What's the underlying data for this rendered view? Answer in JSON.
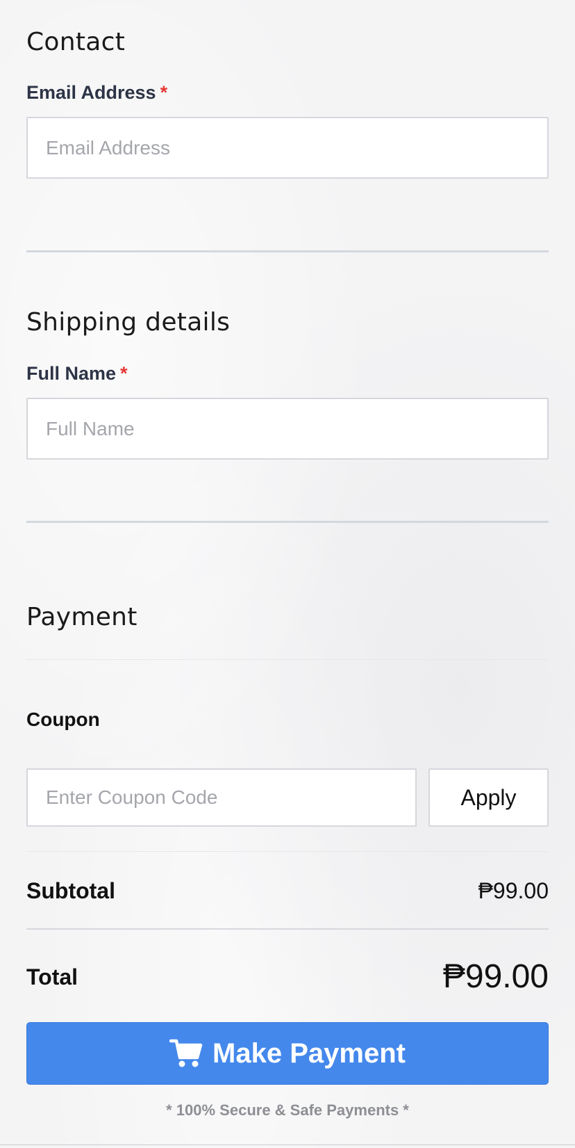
{
  "contact": {
    "title": "Contact",
    "email_label": "Email Address",
    "email_required": "*",
    "email_placeholder": "Email Address",
    "email_value": ""
  },
  "shipping": {
    "title": "Shipping details",
    "name_label": "Full Name",
    "name_required": "*",
    "name_placeholder": "Full Name",
    "name_value": ""
  },
  "payment": {
    "title": "Payment",
    "coupon_label": "Coupon",
    "coupon_placeholder": "Enter Coupon Code",
    "coupon_value": "",
    "apply_label": "Apply"
  },
  "summary": {
    "subtotal_label": "Subtotal",
    "subtotal_value": "₱99.00",
    "total_label": "Total",
    "total_value": "₱99.00"
  },
  "cta": {
    "pay_label": "Make Payment",
    "pay_icon": "shopping-cart-icon",
    "secure_note": "* 100% Secure & Safe Payments *"
  },
  "colors": {
    "primary_button": "#4488ec",
    "required_marker": "#e53935",
    "label_text": "#2d3446",
    "muted_text": "#8d8f93"
  }
}
